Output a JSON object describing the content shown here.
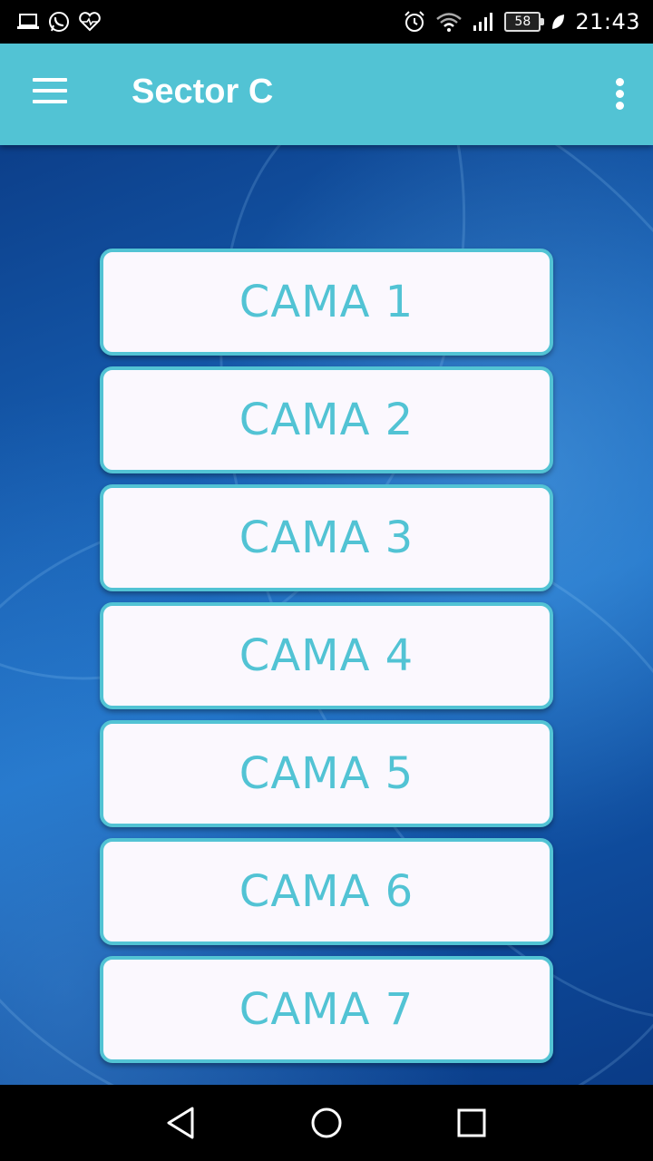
{
  "status_bar": {
    "left_icons": [
      "laptop-icon",
      "whatsapp-icon",
      "heart-pulse-icon"
    ],
    "right_icons": [
      "alarm-icon",
      "wifi-icon",
      "signal-icon"
    ],
    "battery_level": "58",
    "time": "21:43"
  },
  "app_bar": {
    "title": "Sector C",
    "background_color": "#52c3d4"
  },
  "beds": [
    {
      "label": "CAMA 1"
    },
    {
      "label": "CAMA 2"
    },
    {
      "label": "CAMA 3"
    },
    {
      "label": "CAMA 4"
    },
    {
      "label": "CAMA 5"
    },
    {
      "label": "CAMA 6"
    },
    {
      "label": "CAMA 7"
    }
  ],
  "nav_bar": {
    "icons": [
      "back-triangle-icon",
      "home-circle-icon",
      "recents-square-icon"
    ]
  }
}
